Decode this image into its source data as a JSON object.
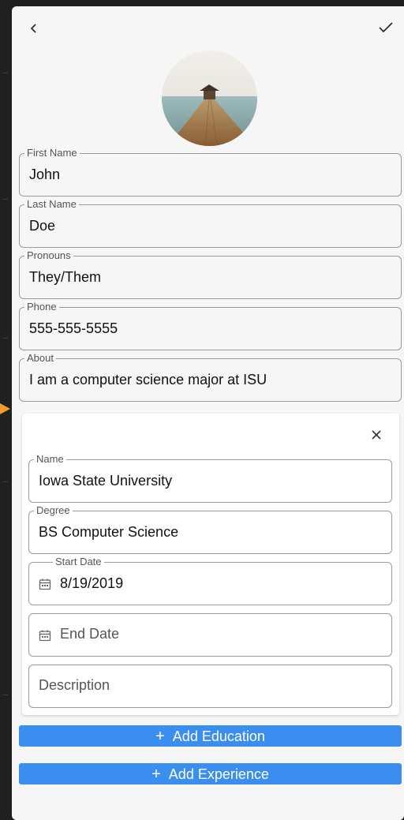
{
  "header": {
    "back_icon": "chevron-left-icon",
    "save_icon": "checkmark-icon"
  },
  "profile": {
    "avatar": "pier-photo",
    "fields": {
      "first_name": {
        "label": "First Name",
        "value": "John"
      },
      "last_name": {
        "label": "Last Name",
        "value": "Doe"
      },
      "pronouns": {
        "label": "Pronouns",
        "value": "They/Them"
      },
      "phone": {
        "label": "Phone",
        "value": "555-555-5555"
      },
      "about": {
        "label": "About",
        "value": "I am a computer science major at ISU"
      }
    }
  },
  "education": {
    "close_icon": "close-icon",
    "name": {
      "label": "Name",
      "value": "Iowa State University"
    },
    "degree": {
      "label": "Degree",
      "value": "BS Computer Science"
    },
    "start_date": {
      "label": "Start Date",
      "value": "8/19/2019"
    },
    "end_date": {
      "placeholder": "End Date"
    },
    "description": {
      "placeholder": "Description"
    }
  },
  "actions": {
    "add_education": {
      "icon": "+",
      "label": "Add Education"
    },
    "add_experience": {
      "icon": "+",
      "label": "Add Experience"
    }
  },
  "colors": {
    "accent": "#3a8eef",
    "background": "#f6f6f6",
    "outer": "#1f1f1f",
    "pointer": "#f29b2a"
  }
}
